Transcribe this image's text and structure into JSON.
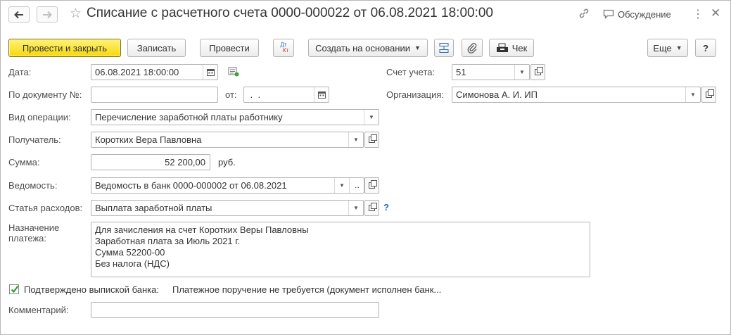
{
  "window": {
    "title": "Списание с расчетного счета 0000-000022 от 06.08.2021 18:00:00",
    "discussion_label": "Обсуждение"
  },
  "icons": {
    "back": "arrow-left-icon",
    "forward": "arrow-right-icon",
    "favorite": "star-icon",
    "link": "link-icon",
    "discussion": "speech-bubble-icon",
    "more": "kebab-icon",
    "close": "close-icon"
  },
  "toolbar": {
    "post_close_label": "Провести и закрыть",
    "save_label": "Записать",
    "post_label": "Провести",
    "dtkt_top": "Дт",
    "dtkt_bottom": "Кт",
    "create_based_label": "Создать на основании",
    "receipt_label": "Чек",
    "more_label": "Еще",
    "help_label": "?"
  },
  "form": {
    "date": {
      "label": "Дата:",
      "value": "06.08.2021 18:00:00"
    },
    "doc_number": {
      "label": "По документу №:",
      "value": ""
    },
    "doc_from": {
      "label": "от:",
      "value": " .  .    "
    },
    "account": {
      "label": "Счет учета:",
      "value": "51"
    },
    "organization": {
      "label": "Организация:",
      "value": "Симонова А. И. ИП"
    },
    "operation_type": {
      "label": "Вид операции:",
      "value": "Перечисление заработной платы работнику"
    },
    "recipient": {
      "label": "Получатель:",
      "value": "Коротких Вера Павловна"
    },
    "amount": {
      "label": "Сумма:",
      "value": "52 200,00",
      "currency": "руб."
    },
    "statement": {
      "label": "Ведомость:",
      "value": "Ведомость в банк 0000-000002 от 06.08.2021",
      "ellipsis": "..."
    },
    "expense_item": {
      "label": "Статья расходов:",
      "value": "Выплата заработной платы",
      "help": "?"
    },
    "purpose": {
      "label_line1": "Назначение",
      "label_line2": "платежа:",
      "lines": [
        "Для зачисления на счет Коротких Веры Павловны",
        "Заработная плата за Июль 2021 г.",
        "Сумма 52200-00",
        "Без налога (НДС)"
      ]
    },
    "bank_confirmed": {
      "label": "Подтверждено выпиской банка:",
      "checked": true,
      "info": "Платежное поручение не требуется (документ исполнен банк..."
    },
    "comment": {
      "label": "Комментарий:",
      "value": ""
    }
  },
  "colors": {
    "primary_button": "#f5d90a",
    "help_blue": "#1f6fb5",
    "check_green": "#2e9b2e"
  }
}
